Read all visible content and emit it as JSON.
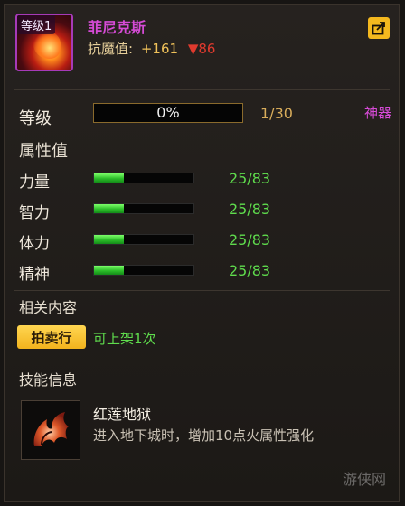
{
  "item": {
    "level_badge": "等级1",
    "name": "菲尼克斯",
    "resist_label": "抗魔值:",
    "resist_plus": "+161",
    "resist_minus": "▼86"
  },
  "level": {
    "label": "等级",
    "progress_text": "0%",
    "progress_value": 0,
    "count": "1/30",
    "artifact_tag": "神器"
  },
  "attributes": {
    "title": "属性值",
    "items": [
      {
        "label": "力量",
        "value": "25/83",
        "fraction": 0.3
      },
      {
        "label": "智力",
        "value": "25/83",
        "fraction": 0.3
      },
      {
        "label": "体力",
        "value": "25/83",
        "fraction": 0.3
      },
      {
        "label": "精神",
        "value": "25/83",
        "fraction": 0.3
      }
    ]
  },
  "related": {
    "title": "相关内容",
    "auction_button": "拍卖行",
    "auction_note": "可上架1次"
  },
  "skill": {
    "title": "技能信息",
    "name": "红莲地狱",
    "desc": "进入地下城时，增加10点火属性强化"
  },
  "watermark": "游侠网",
  "colors": {
    "accent_purple": "#d64bd6",
    "accent_green": "#5fdc4d",
    "accent_gold": "#f4b81e",
    "down_red": "#e03a2e"
  },
  "icons": {
    "share": "share-icon",
    "skill": "phoenix-flame-icon"
  }
}
